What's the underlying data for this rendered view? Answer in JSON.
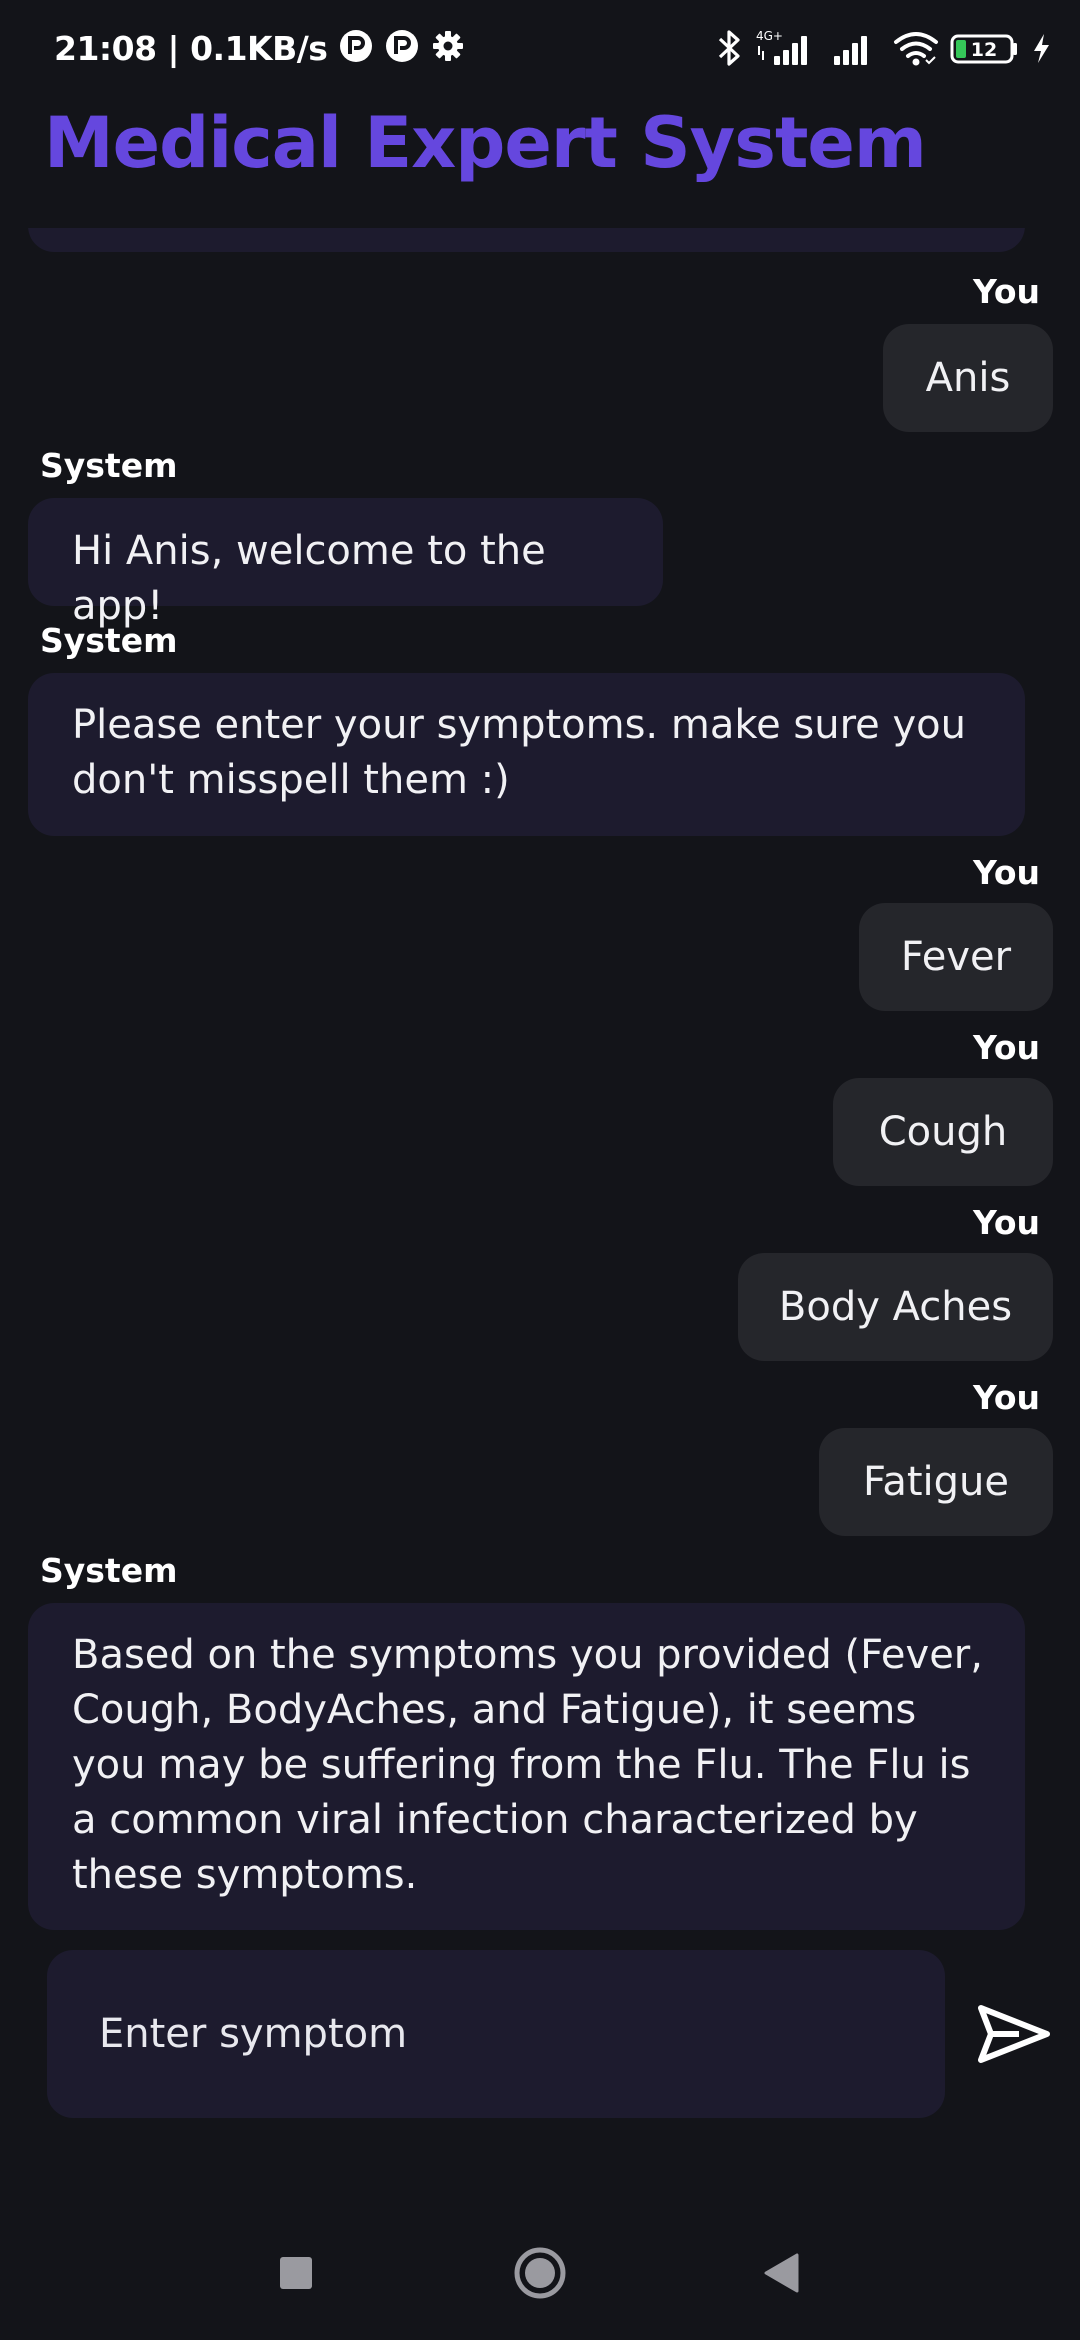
{
  "status_bar": {
    "time_speed": "21:08 | 0.1KB/s",
    "network_type": "4G+",
    "battery_level": "12",
    "icons": [
      "app-notification-icon",
      "app-notification-icon",
      "settings-gear-icon",
      "bluetooth-icon",
      "signal-icon",
      "signal-icon",
      "wifi-icon",
      "battery-icon",
      "charging-bolt-icon"
    ]
  },
  "app": {
    "title": "Medical Expert System",
    "accent_color": "#6547de"
  },
  "messages": [
    {
      "sender": "You",
      "text": "Anis"
    },
    {
      "sender": "System",
      "text": "Hi Anis, welcome to the app!"
    },
    {
      "sender": "System",
      "text": "Please enter your symptoms. make sure you don't misspell them :)"
    },
    {
      "sender": "You",
      "text": "Fever"
    },
    {
      "sender": "You",
      "text": "Cough"
    },
    {
      "sender": "You",
      "text": "Body Aches"
    },
    {
      "sender": "You",
      "text": "Fatigue"
    },
    {
      "sender": "System",
      "text": "Based on the symptoms you provided (Fever, Cough, BodyAches, and Fatigue), it seems you may be suffering from the Flu. The Flu is a common viral infection characterized by these symptoms."
    }
  ],
  "input": {
    "placeholder": "Enter symptom",
    "send_icon": "send-icon"
  },
  "nav_bar": {
    "icons": [
      "recents-square-icon",
      "home-circle-icon",
      "back-triangle-icon"
    ]
  }
}
